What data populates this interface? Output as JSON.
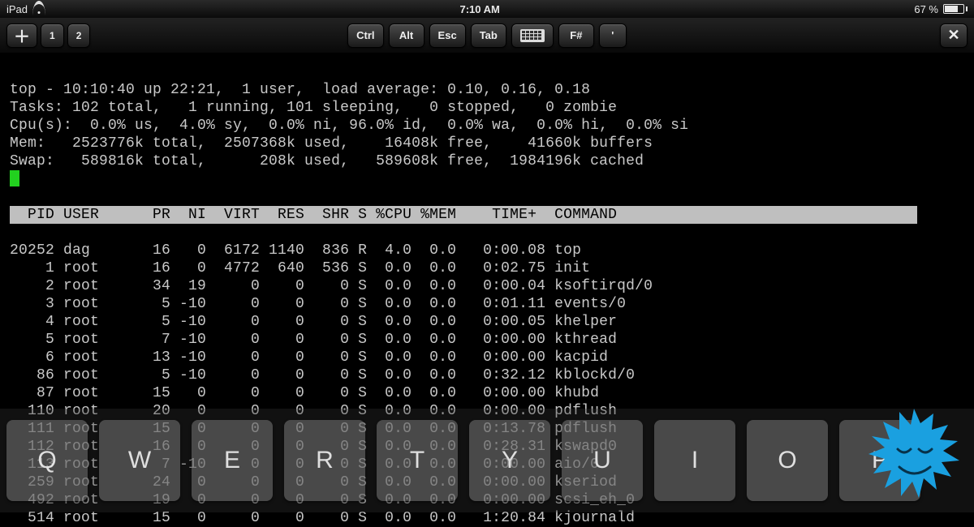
{
  "status": {
    "device": "iPad",
    "time": "7:10 AM",
    "battery_pct": "67 %"
  },
  "toolbar": {
    "plus": "＋",
    "tab1": "1",
    "tab2": "2",
    "ctrl": "Ctrl",
    "alt": "Alt",
    "esc": "Esc",
    "tab": "Tab",
    "fnum": "F#",
    "apostrophe": "'",
    "close": "✕"
  },
  "top": {
    "summary": [
      "top - 10:10:40 up 22:21,  1 user,  load average: 0.10, 0.16, 0.18",
      "Tasks: 102 total,   1 running, 101 sleeping,   0 stopped,   0 zombie",
      "Cpu(s):  0.0% us,  4.0% sy,  0.0% ni, 96.0% id,  0.0% wa,  0.0% hi,  0.0% si",
      "Mem:   2523776k total,  2507368k used,    16408k free,    41660k buffers",
      "Swap:   589816k total,      208k used,   589608k free,  1984196k cached"
    ],
    "header": "  PID USER      PR  NI  VIRT  RES  SHR S %CPU %MEM    TIME+  COMMAND          ",
    "rows": [
      "20252 dag       16   0  6172 1140  836 R  4.0  0.0   0:00.08 top",
      "    1 root      16   0  4772  640  536 S  0.0  0.0   0:02.75 init",
      "    2 root      34  19     0    0    0 S  0.0  0.0   0:00.04 ksoftirqd/0",
      "    3 root       5 -10     0    0    0 S  0.0  0.0   0:01.11 events/0",
      "    4 root       5 -10     0    0    0 S  0.0  0.0   0:00.05 khelper",
      "    5 root       7 -10     0    0    0 S  0.0  0.0   0:00.00 kthread",
      "    6 root      13 -10     0    0    0 S  0.0  0.0   0:00.00 kacpid",
      "   86 root       5 -10     0    0    0 S  0.0  0.0   0:32.12 kblockd/0",
      "   87 root      15   0     0    0    0 S  0.0  0.0   0:00.00 khubd",
      "  110 root      20   0     0    0    0 S  0.0  0.0   0:00.00 pdflush",
      "  111 root      15   0     0    0    0 S  0.0  0.0   0:13.78 pdflush",
      "  112 root      16   0     0    0    0 S  0.0  0.0   0:28.31 kswapd0",
      "  113 root       7 -10     0    0    0 S  0.0  0.0   0:00.00 aio/0",
      "  259 root      24   0     0    0    0 S  0.0  0.0   0:00.00 kseriod",
      "  492 root      19   0     0    0    0 S  0.0  0.0   0:00.00 scsi_eh_0",
      "  514 root      15   0     0    0    0 S  0.0  0.0   1:20.84 kjournald"
    ]
  },
  "osk_keys": [
    "Q",
    "W",
    "E",
    "R",
    "T",
    "Y",
    "U",
    "I",
    "O",
    "P"
  ],
  "colors": {
    "terminal_fg": "#c9c9c9",
    "cursor": "#22d11f",
    "mascot": "#1aa0e0"
  }
}
